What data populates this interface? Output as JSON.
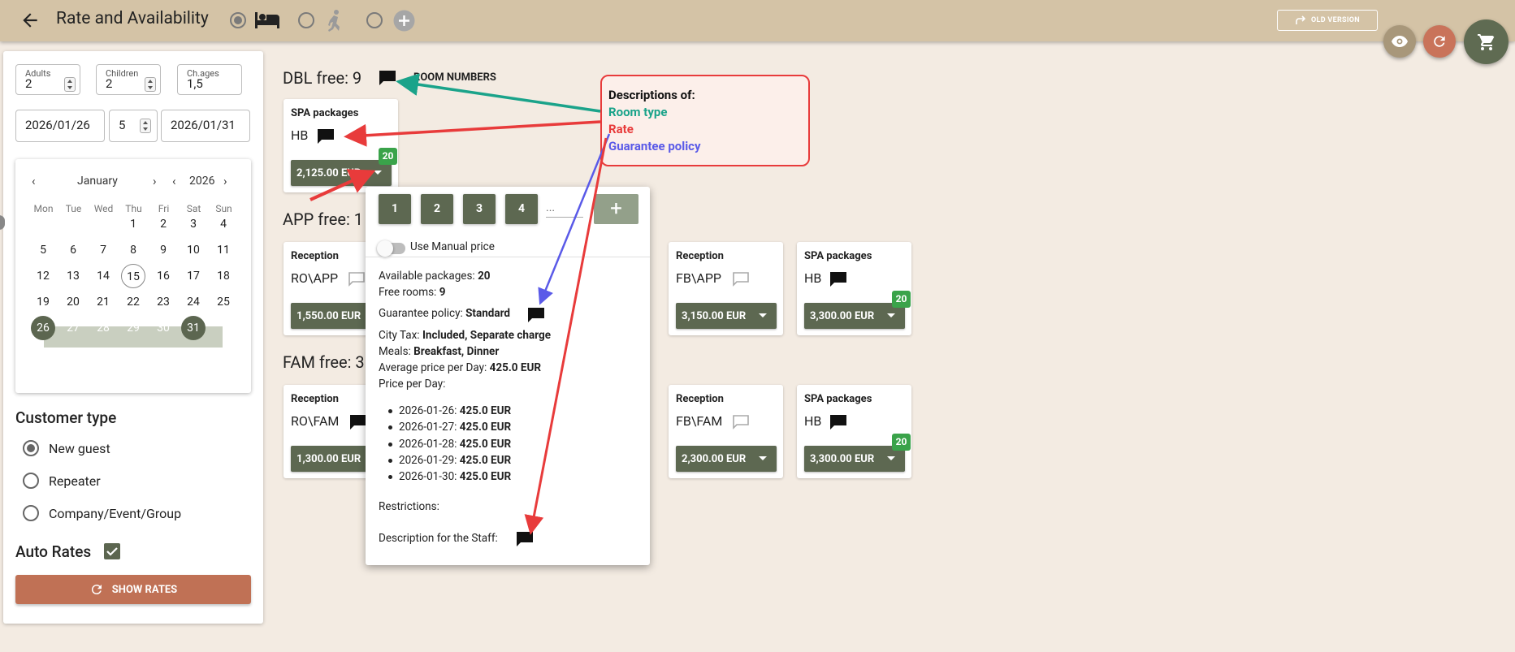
{
  "header": {
    "title": "Rate and Availability",
    "old_version_label": "OLD VERSION",
    "colors": {
      "bar": "#d4c3a6",
      "eye_fab": "#a8977a",
      "refresh_fab": "#c9735a",
      "cart_fab": "#5f6b52"
    }
  },
  "search": {
    "adults_label": "Adults",
    "adults_value": "2",
    "children_label": "Children",
    "children_value": "2",
    "ch_ages_label": "Ch.ages",
    "ch_ages_value": "1,5",
    "checkin": "2026/01/26",
    "nights": "5",
    "checkout": "2026/01/31"
  },
  "calendar": {
    "month": "January",
    "year": "2026",
    "dow": [
      "Mon",
      "Tue",
      "Wed",
      "Thu",
      "Fri",
      "Sat",
      "Sun"
    ],
    "weeks": [
      [
        "",
        "",
        "",
        "1",
        "2",
        "3",
        "4"
      ],
      [
        "5",
        "6",
        "7",
        "8",
        "9",
        "10",
        "11"
      ],
      [
        "12",
        "13",
        "14",
        "15",
        "16",
        "17",
        "18"
      ],
      [
        "19",
        "20",
        "21",
        "22",
        "23",
        "24",
        "25"
      ],
      [
        "26",
        "27",
        "28",
        "29",
        "30",
        "31",
        ""
      ]
    ],
    "today": "15",
    "range_start": "26",
    "range_end": "31"
  },
  "customer_type": {
    "title": "Customer type",
    "options": [
      "New guest",
      "Repeater",
      "Company/Event/Group"
    ],
    "selected": "New guest"
  },
  "auto_rates": {
    "label": "Auto Rates",
    "checked": true
  },
  "show_rates_label": "SHOW RATES",
  "rooms": {
    "dbl": {
      "heading": "DBL free: 9",
      "note": "ROOM NUMBERS",
      "cards": [
        {
          "title": "SPA packages",
          "rate": "HB",
          "price": "2,125.00 EUR",
          "badge": "20"
        }
      ]
    },
    "app": {
      "heading": "APP free: 1",
      "cards": [
        {
          "title": "Reception",
          "rate": "RO\\APP",
          "price": "1,550.00 EUR"
        },
        {
          "title": "Reception",
          "rate": "FB\\APP",
          "price": "3,150.00 EUR"
        },
        {
          "title": "SPA packages",
          "rate": "HB",
          "price": "3,300.00 EUR",
          "badge": "20"
        }
      ]
    },
    "fam": {
      "heading": "FAM free: 3",
      "cards": [
        {
          "title": "Reception",
          "rate": "RO\\FAM",
          "price": "1,300.00 EUR"
        },
        {
          "title": "Reception",
          "rate": "FB\\FAM",
          "price": "2,300.00 EUR"
        },
        {
          "title": "SPA packages",
          "rate": "HB",
          "price": "3,300.00 EUR",
          "badge": "20"
        }
      ]
    }
  },
  "popup": {
    "pax_buttons": [
      "1",
      "2",
      "3",
      "4"
    ],
    "more_label": "...",
    "manual_price_label": "Use Manual price",
    "available_packages_label": "Available packages:",
    "available_packages": "20",
    "free_rooms_label": "Free rooms:",
    "free_rooms": "9",
    "guarantee_label": "Guarantee policy:",
    "guarantee": "Standard",
    "city_tax_label": "City Tax:",
    "city_tax": "Included, Separate charge",
    "meals_label": "Meals:",
    "meals": "Breakfast, Dinner",
    "avg_price_label": "Average price per Day:",
    "avg_price": "425.0 EUR",
    "price_per_day_label": "Price per Day:",
    "price_per_day": [
      {
        "date": "2026-01-26:",
        "price": "425.0 EUR"
      },
      {
        "date": "2026-01-27:",
        "price": "425.0 EUR"
      },
      {
        "date": "2026-01-28:",
        "price": "425.0 EUR"
      },
      {
        "date": "2026-01-29:",
        "price": "425.0 EUR"
      },
      {
        "date": "2026-01-30:",
        "price": "425.0 EUR"
      }
    ],
    "restrictions_label": "Restrictions:",
    "staff_desc_label": "Description for the Staff:"
  },
  "annotation": {
    "heading": "Descriptions of:",
    "lines": [
      {
        "text": "Room type",
        "color": "#1aa38a"
      },
      {
        "text": "Rate",
        "color": "#e83b3b"
      },
      {
        "text": "Guarantee policy",
        "color": "#5a5ae8"
      }
    ]
  }
}
